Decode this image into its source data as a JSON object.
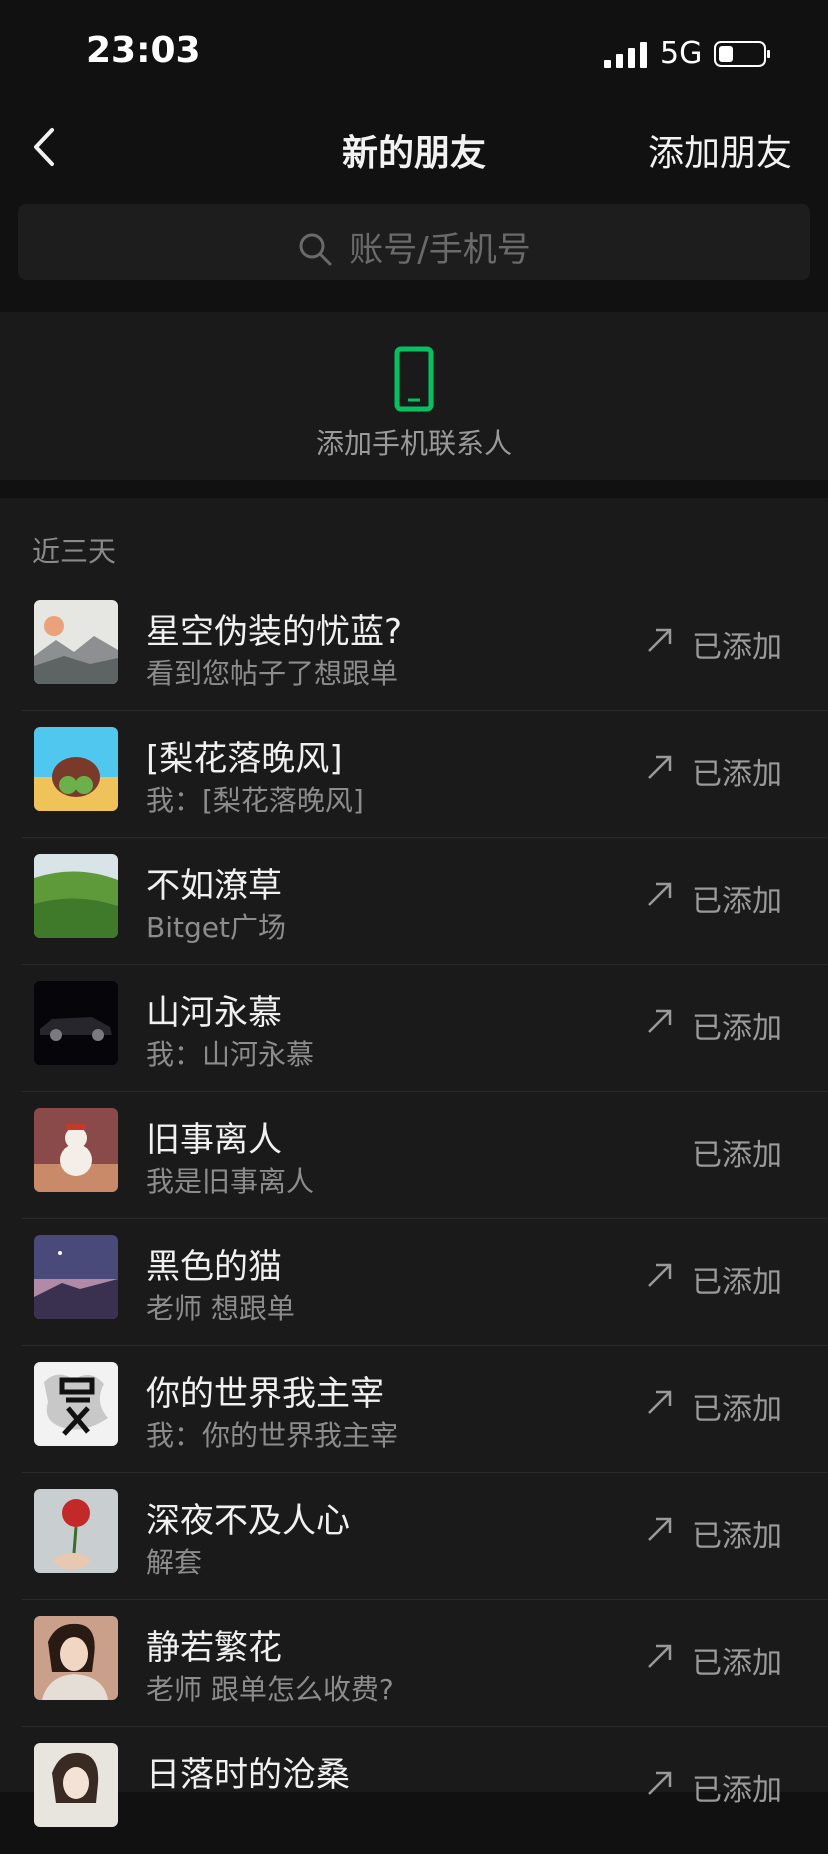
{
  "status": {
    "time": "23:03",
    "network": "5G"
  },
  "nav": {
    "title": "新的朋友",
    "action": "添加朋友"
  },
  "search": {
    "placeholder": "账号/手机号"
  },
  "phone_contacts": {
    "label": "添加手机联系人"
  },
  "section_header": "近三天",
  "contacts": [
    {
      "name": "星空伪装的忧蓝?",
      "sub": "看到您帖子了想跟单",
      "status": "已添加",
      "arrow": true
    },
    {
      "name": "[梨花落晚风]",
      "sub": "我：[梨花落晚风]",
      "status": "已添加",
      "arrow": true
    },
    {
      "name": "不如潦草",
      "sub": "Bitget广场",
      "status": "已添加",
      "arrow": true
    },
    {
      "name": "山河永慕",
      "sub": "我：山河永慕",
      "status": "已添加",
      "arrow": true
    },
    {
      "name": "旧事离人",
      "sub": "我是旧事离人",
      "status": "已添加",
      "arrow": false
    },
    {
      "name": "黑色的猫",
      "sub": "老师 想跟单",
      "status": "已添加",
      "arrow": true
    },
    {
      "name": "你的世界我主宰",
      "sub": "我：你的世界我主宰",
      "status": "已添加",
      "arrow": true
    },
    {
      "name": "深夜不及人心",
      "sub": "解套",
      "status": "已添加",
      "arrow": true
    },
    {
      "name": "静若繁花",
      "sub": "老师 跟单怎么收费?",
      "status": "已添加",
      "arrow": true
    },
    {
      "name": "日落时的沧桑",
      "sub": "",
      "status": "已添加",
      "arrow": true
    }
  ],
  "colors": {
    "background": "#111111",
    "accent": "#07c160"
  }
}
